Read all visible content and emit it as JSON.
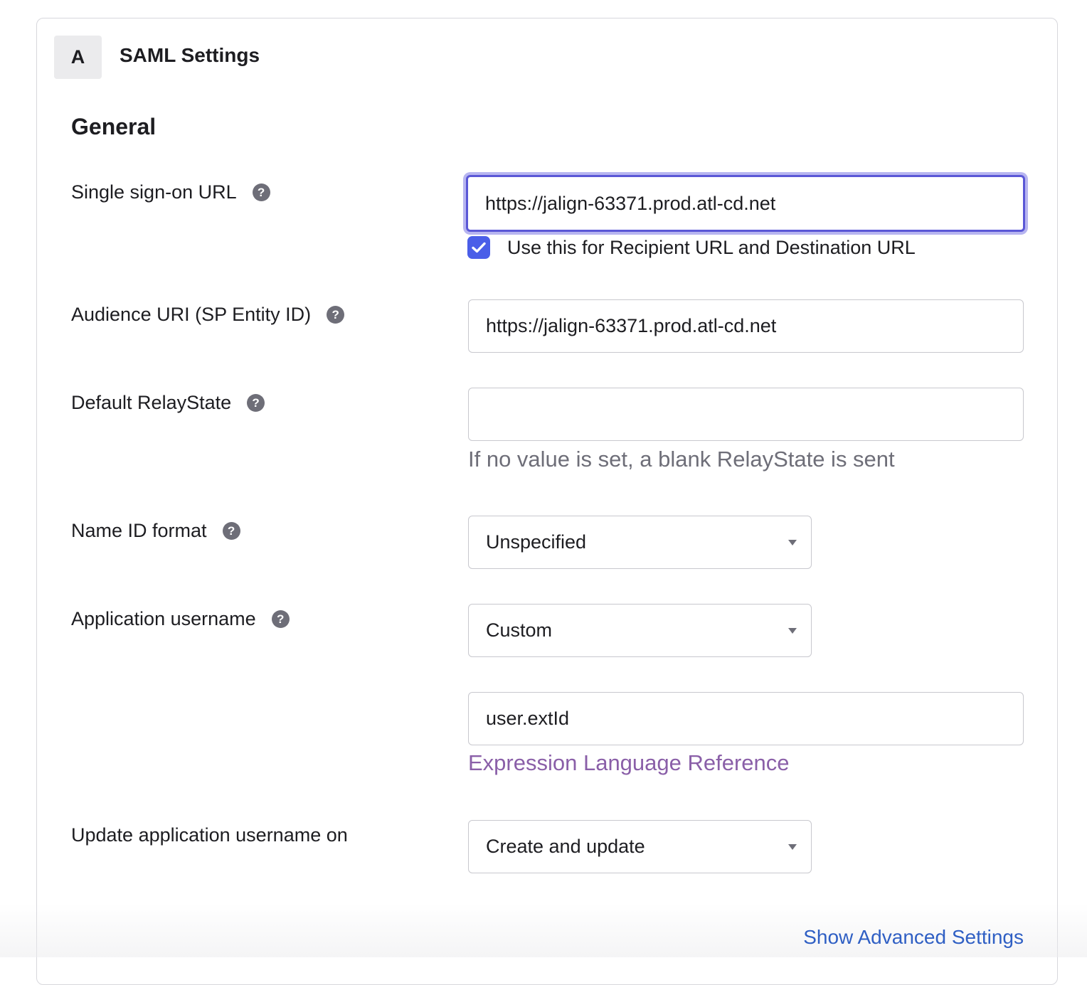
{
  "header": {
    "step_letter": "A",
    "title": "SAML Settings"
  },
  "section": {
    "title": "General"
  },
  "fields": {
    "sso_url": {
      "label": "Single sign-on URL",
      "value": "https://jalign-63371.prod.atl-cd.net",
      "checkbox_label": "Use this for Recipient URL and Destination URL",
      "checkbox_checked": true
    },
    "audience_uri": {
      "label": "Audience URI (SP Entity ID)",
      "value": "https://jalign-63371.prod.atl-cd.net"
    },
    "relay_state": {
      "label": "Default RelayState",
      "value": "",
      "hint": "If no value is set, a blank RelayState is sent"
    },
    "name_id_format": {
      "label": "Name ID format",
      "selected": "Unspecified"
    },
    "app_username": {
      "label": "Application username",
      "selected": "Custom",
      "expression_value": "user.extId",
      "reference_link": "Expression Language Reference"
    },
    "update_username_on": {
      "label": "Update application username on",
      "selected": "Create and update"
    }
  },
  "footer": {
    "advanced_link": "Show Advanced Settings"
  },
  "colors": {
    "focus_border": "#5a57d6",
    "checkbox": "#4a5ee8",
    "link_purple": "#8a5fa8",
    "link_blue": "#2f5fc4"
  },
  "icons": {
    "help": "question-mark-circle",
    "checkbox": "checkmark",
    "dropdown": "caret-down"
  }
}
